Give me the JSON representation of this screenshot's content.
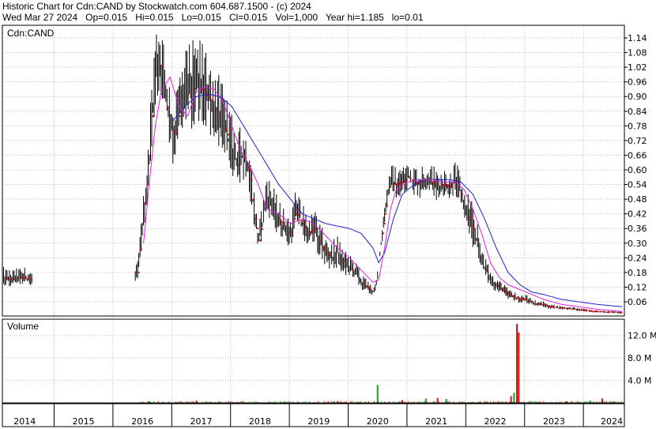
{
  "header": {
    "line1": "Historic Chart for Cdn:CAND by Stockwatch.com 604.687.1500 - (c) 2024",
    "line2": "Wed Mar 27 2024   Op=0.015   Hi=0.015   Lo=0.015   Cl=0.015   Vol=1,000   Year hi=1.185   lo=0.01"
  },
  "colors": {
    "price_bar": "#000000",
    "close_dot": "#d01010",
    "ma_short": "#e020e0",
    "ma_long": "#2020d0",
    "volume_up": "#20a020",
    "volume_down": "#d01010",
    "grid": "#bdbdbd"
  },
  "chart_data": [
    {
      "type": "line",
      "name": "price",
      "title": "Cdn:CAND",
      "grid": true,
      "ylim": [
        0,
        1.185
      ],
      "y_ticks": [
        "1.14",
        "1.08",
        "1.02",
        "0.96",
        "0.90",
        "0.84",
        "0.78",
        "0.72",
        "0.66",
        "0.60",
        "0.54",
        "0.48",
        "0.42",
        "0.36",
        "0.30",
        "0.24",
        "0.18",
        "0.12",
        "0.06"
      ],
      "x_ticks": [
        "2014",
        "2015",
        "2016",
        "2017",
        "2018",
        "2019",
        "2020",
        "2021",
        "2022",
        "2023",
        "2024"
      ],
      "price_path": [
        [
          2013.7,
          0.16
        ],
        [
          2013.85,
          0.15
        ],
        [
          2014.05,
          0.16
        ],
        [
          2014.2,
          0.15
        ],
        [
          2015.95,
          0.15
        ],
        [
          2016.0,
          0.18
        ],
        [
          2016.05,
          0.3
        ],
        [
          2016.12,
          0.46
        ],
        [
          2016.18,
          0.58
        ],
        [
          2016.24,
          0.82
        ],
        [
          2016.3,
          0.98
        ],
        [
          2016.36,
          1.05
        ],
        [
          2016.42,
          0.98
        ],
        [
          2016.48,
          0.88
        ],
        [
          2016.55,
          0.8
        ],
        [
          2016.62,
          0.74
        ],
        [
          2016.7,
          0.82
        ],
        [
          2016.8,
          0.9
        ],
        [
          2016.9,
          0.92
        ],
        [
          2017.0,
          0.94
        ],
        [
          2017.1,
          0.93
        ],
        [
          2017.2,
          0.9
        ],
        [
          2017.3,
          0.86
        ],
        [
          2017.4,
          0.8
        ],
        [
          2017.5,
          0.76
        ],
        [
          2017.6,
          0.68
        ],
        [
          2017.7,
          0.62
        ],
        [
          2017.8,
          0.66
        ],
        [
          2017.9,
          0.6
        ],
        [
          2018.0,
          0.4
        ],
        [
          2018.05,
          0.3
        ],
        [
          2018.12,
          0.38
        ],
        [
          2018.2,
          0.5
        ],
        [
          2018.3,
          0.44
        ],
        [
          2018.4,
          0.4
        ],
        [
          2018.5,
          0.36
        ],
        [
          2018.6,
          0.34
        ],
        [
          2018.7,
          0.44
        ],
        [
          2018.8,
          0.38
        ],
        [
          2018.9,
          0.34
        ],
        [
          2019.0,
          0.36
        ],
        [
          2019.1,
          0.3
        ],
        [
          2019.2,
          0.26
        ],
        [
          2019.3,
          0.24
        ],
        [
          2019.4,
          0.26
        ],
        [
          2019.5,
          0.22
        ],
        [
          2019.6,
          0.2
        ],
        [
          2019.7,
          0.18
        ],
        [
          2019.8,
          0.14
        ],
        [
          2019.9,
          0.12
        ],
        [
          2020.0,
          0.1
        ],
        [
          2020.05,
          0.12
        ],
        [
          2020.1,
          0.2
        ],
        [
          2020.15,
          0.32
        ],
        [
          2020.2,
          0.42
        ],
        [
          2020.25,
          0.5
        ],
        [
          2020.3,
          0.55
        ],
        [
          2020.4,
          0.54
        ],
        [
          2020.5,
          0.55
        ],
        [
          2020.6,
          0.57
        ],
        [
          2020.7,
          0.55
        ],
        [
          2020.8,
          0.54
        ],
        [
          2020.9,
          0.56
        ],
        [
          2021.0,
          0.55
        ],
        [
          2021.1,
          0.53
        ],
        [
          2021.2,
          0.54
        ],
        [
          2021.3,
          0.53
        ],
        [
          2021.4,
          0.56
        ],
        [
          2021.45,
          0.54
        ],
        [
          2021.5,
          0.5
        ],
        [
          2021.6,
          0.42
        ],
        [
          2021.7,
          0.36
        ],
        [
          2021.8,
          0.28
        ],
        [
          2021.9,
          0.2
        ],
        [
          2022.0,
          0.15
        ],
        [
          2022.1,
          0.13
        ],
        [
          2022.2,
          0.11
        ],
        [
          2022.3,
          0.09
        ],
        [
          2022.4,
          0.08
        ],
        [
          2022.5,
          0.07
        ],
        [
          2022.6,
          0.07
        ],
        [
          2022.7,
          0.06
        ],
        [
          2022.8,
          0.05
        ],
        [
          2022.9,
          0.05
        ],
        [
          2023.0,
          0.04
        ],
        [
          2023.2,
          0.035
        ],
        [
          2023.4,
          0.03
        ],
        [
          2023.6,
          0.025
        ],
        [
          2023.8,
          0.02
        ],
        [
          2024.0,
          0.018
        ],
        [
          2024.24,
          0.015
        ]
      ],
      "ma_short": [
        [
          2016.1,
          0.3
        ],
        [
          2016.2,
          0.55
        ],
        [
          2016.3,
          0.78
        ],
        [
          2016.4,
          0.92
        ],
        [
          2016.55,
          0.98
        ],
        [
          2016.7,
          0.86
        ],
        [
          2016.85,
          0.82
        ],
        [
          2017.0,
          0.92
        ],
        [
          2017.15,
          0.94
        ],
        [
          2017.3,
          0.93
        ],
        [
          2017.45,
          0.88
        ],
        [
          2017.6,
          0.78
        ],
        [
          2017.75,
          0.68
        ],
        [
          2017.9,
          0.62
        ],
        [
          2018.05,
          0.54
        ],
        [
          2018.2,
          0.44
        ],
        [
          2018.4,
          0.42
        ],
        [
          2018.6,
          0.38
        ],
        [
          2018.8,
          0.4
        ],
        [
          2019.0,
          0.38
        ],
        [
          2019.2,
          0.33
        ],
        [
          2019.4,
          0.28
        ],
        [
          2019.6,
          0.24
        ],
        [
          2019.8,
          0.19
        ],
        [
          2020.0,
          0.14
        ],
        [
          2020.1,
          0.15
        ],
        [
          2020.2,
          0.28
        ],
        [
          2020.3,
          0.44
        ],
        [
          2020.4,
          0.52
        ],
        [
          2020.6,
          0.55
        ],
        [
          2020.8,
          0.56
        ],
        [
          2021.0,
          0.56
        ],
        [
          2021.2,
          0.55
        ],
        [
          2021.4,
          0.55
        ],
        [
          2021.55,
          0.52
        ],
        [
          2021.7,
          0.44
        ],
        [
          2021.85,
          0.34
        ],
        [
          2022.0,
          0.22
        ],
        [
          2022.15,
          0.16
        ],
        [
          2022.3,
          0.13
        ],
        [
          2022.5,
          0.11
        ],
        [
          2022.7,
          0.09
        ],
        [
          2022.9,
          0.07
        ],
        [
          2023.2,
          0.05
        ],
        [
          2023.5,
          0.04
        ],
        [
          2023.8,
          0.03
        ],
        [
          2024.24,
          0.02
        ]
      ],
      "ma_long": [
        [
          2016.6,
          0.8
        ],
        [
          2016.8,
          0.86
        ],
        [
          2017.0,
          0.9
        ],
        [
          2017.2,
          0.91
        ],
        [
          2017.4,
          0.9
        ],
        [
          2017.6,
          0.86
        ],
        [
          2017.8,
          0.78
        ],
        [
          2018.0,
          0.7
        ],
        [
          2018.2,
          0.62
        ],
        [
          2018.4,
          0.54
        ],
        [
          2018.6,
          0.48
        ],
        [
          2018.8,
          0.42
        ],
        [
          2019.0,
          0.4
        ],
        [
          2019.2,
          0.38
        ],
        [
          2019.4,
          0.37
        ],
        [
          2019.6,
          0.36
        ],
        [
          2019.8,
          0.34
        ],
        [
          2020.0,
          0.28
        ],
        [
          2020.1,
          0.22
        ],
        [
          2020.2,
          0.26
        ],
        [
          2020.35,
          0.4
        ],
        [
          2020.5,
          0.5
        ],
        [
          2020.7,
          0.54
        ],
        [
          2020.9,
          0.56
        ],
        [
          2021.1,
          0.56
        ],
        [
          2021.3,
          0.56
        ],
        [
          2021.5,
          0.55
        ],
        [
          2021.7,
          0.5
        ],
        [
          2021.9,
          0.4
        ],
        [
          2022.1,
          0.28
        ],
        [
          2022.3,
          0.18
        ],
        [
          2022.5,
          0.13
        ],
        [
          2022.7,
          0.1
        ],
        [
          2022.9,
          0.09
        ],
        [
          2023.2,
          0.07
        ],
        [
          2023.5,
          0.06
        ],
        [
          2023.8,
          0.05
        ],
        [
          2024.0,
          0.045
        ],
        [
          2024.24,
          0.04
        ]
      ]
    },
    {
      "type": "bar",
      "name": "volume",
      "title": "Volume",
      "ylim": [
        0,
        14000000
      ],
      "y_ticks": [
        "12.0 M",
        "8.0 M",
        "4.0 M"
      ],
      "spikes": [
        [
          2016.2,
          0.3
        ],
        [
          2017.0,
          0.4
        ],
        [
          2018.5,
          0.3
        ],
        [
          2019.4,
          0.3
        ],
        [
          2020.08,
          3.2
        ],
        [
          2020.5,
          0.5
        ],
        [
          2020.9,
          0.8
        ],
        [
          2021.1,
          0.9
        ],
        [
          2021.25,
          0.7
        ],
        [
          2022.35,
          1.2
        ],
        [
          2022.4,
          1.8
        ],
        [
          2022.45,
          14.0
        ],
        [
          2022.48,
          12.5
        ],
        [
          2023.3,
          0.3
        ],
        [
          2023.7,
          0.4
        ],
        [
          2023.9,
          0.8
        ],
        [
          2024.1,
          0.3
        ]
      ]
    }
  ]
}
